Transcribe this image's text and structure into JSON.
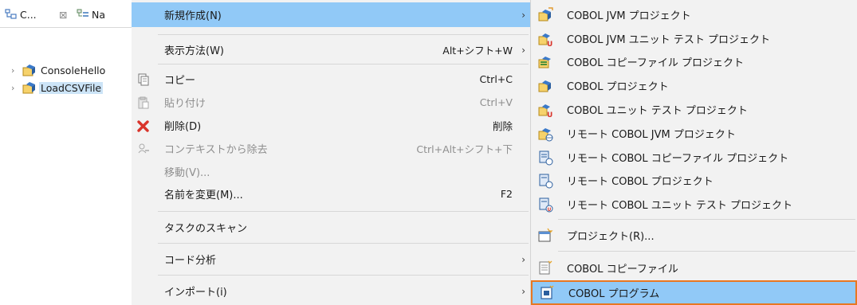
{
  "explorer": {
    "tabs": [
      {
        "label": "C...",
        "icon": "cobol-explorer-icon"
      },
      {
        "label": "Na",
        "icon": "navigator-icon"
      }
    ],
    "tree": [
      {
        "label": "ConsoleHello",
        "selected": false
      },
      {
        "label": "LoadCSVFile",
        "selected": true
      }
    ]
  },
  "context_menu": {
    "items": [
      {
        "label": "新規作成(N)",
        "accel": "",
        "submenu": true,
        "highlighted": true
      },
      {
        "label": "表示方法(W)",
        "accel": "Alt+シフト+W",
        "submenu": true
      },
      {
        "label": "コピー",
        "accel": "Ctrl+C",
        "icon": "copy-icon"
      },
      {
        "label": "貼り付け",
        "accel": "Ctrl+V",
        "icon": "paste-icon",
        "disabled": true
      },
      {
        "label": "削除(D)",
        "accel": "削除",
        "icon": "delete-icon"
      },
      {
        "label": "コンテキストから除去",
        "accel": "Ctrl+Alt+シフト+下",
        "icon": "remove-context-icon",
        "disabled": true
      },
      {
        "label": "移動(V)...",
        "accel": "",
        "disabled": true
      },
      {
        "label": "名前を変更(M)...",
        "accel": "F2"
      },
      {
        "label": "タスクのスキャン",
        "accel": ""
      },
      {
        "label": "コード分析",
        "accel": "",
        "submenu": true
      },
      {
        "label": "インポート(i)",
        "accel": "",
        "submenu": true
      }
    ]
  },
  "submenu": {
    "items": [
      {
        "label": "COBOL JVM プロジェクト"
      },
      {
        "label": "COBOL JVM ユニット テスト プロジェクト"
      },
      {
        "label": "COBOL コピーファイル プロジェクト"
      },
      {
        "label": "COBOL プロジェクト"
      },
      {
        "label": "COBOL ユニット テスト プロジェクト"
      },
      {
        "label": "リモート COBOL JVM プロジェクト"
      },
      {
        "label": "リモート COBOL コピーファイル プロジェクト"
      },
      {
        "label": "リモート COBOL プロジェクト"
      },
      {
        "label": "リモート COBOL ユニット テスト プロジェクト"
      },
      {
        "label": "プロジェクト(R)..."
      },
      {
        "label": "COBOL コピーファイル"
      },
      {
        "label": "COBOL プログラム",
        "active": true
      }
    ]
  },
  "colors": {
    "highlight": "#91c9f7",
    "focus_border": "#e87722",
    "menu_bg": "#f2f2f2",
    "selection_bg": "#cce4f7"
  }
}
